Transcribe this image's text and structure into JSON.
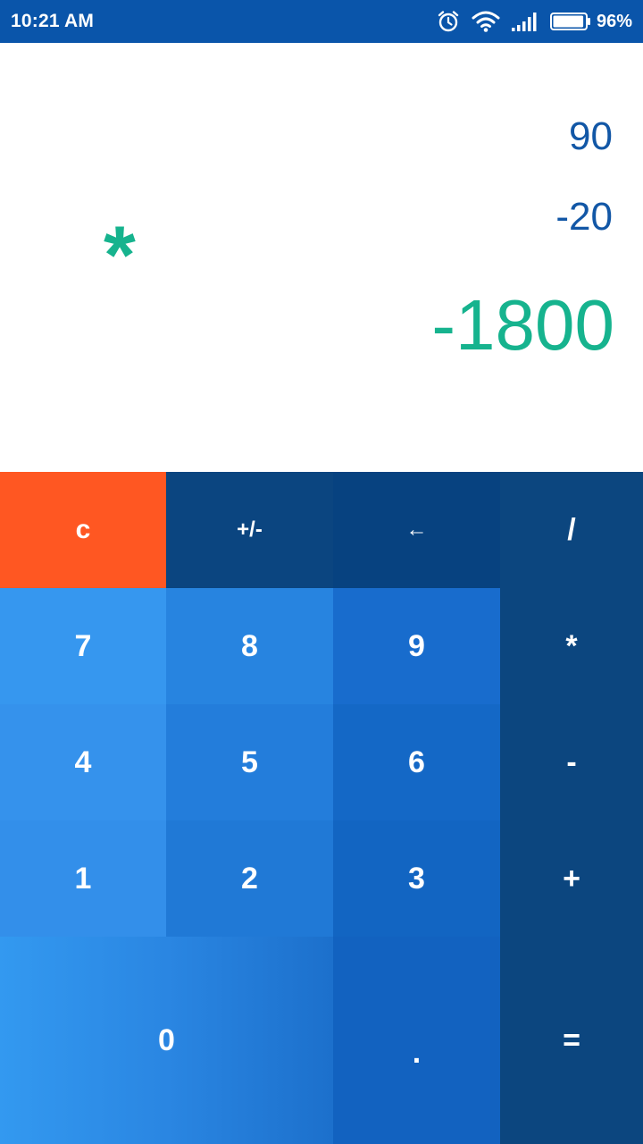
{
  "status_bar": {
    "time": "10:21 AM",
    "battery_percent": "96%",
    "icons": [
      "alarm-icon",
      "wifi-icon",
      "signal-icon",
      "battery-icon"
    ],
    "battery_level": 0.96
  },
  "display": {
    "operand_1": "90",
    "operand_2": "-20",
    "operator": "*",
    "result": "-1800"
  },
  "keys": {
    "clear": "c",
    "plus_minus": "+/-",
    "backspace": "←",
    "divide": "/",
    "seven": "7",
    "eight": "8",
    "nine": "9",
    "multiply": "*",
    "four": "4",
    "five": "5",
    "six": "6",
    "minus": "-",
    "one": "1",
    "two": "2",
    "three": "3",
    "plus": "+",
    "zero": "0",
    "dot": ".",
    "equals": "="
  },
  "colors": {
    "status_bar": "#0a55aa",
    "operand_text": "#1257a6",
    "accent_green": "#16b38e",
    "clear_key": "#ff5722",
    "operator_keys": "#0c467f"
  }
}
